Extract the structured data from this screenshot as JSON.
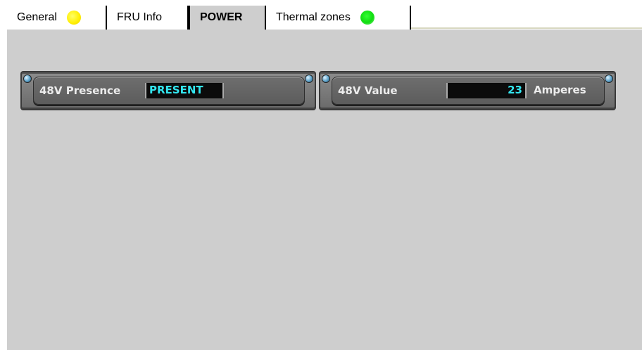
{
  "tabs": [
    {
      "label": "General",
      "status": "yellow"
    },
    {
      "label": "FRU Info"
    },
    {
      "label": "POWER",
      "active": true
    },
    {
      "label": "Thermal zones",
      "status": "green"
    }
  ],
  "widgets": {
    "presence": {
      "label": "48V Presence",
      "value": "PRESENT"
    },
    "value": {
      "label": "48V Value",
      "value": "23",
      "unit": "Amperes"
    }
  },
  "colors": {
    "panel_bg": "#cecece",
    "value_text": "#33e6f0",
    "status_yellow": "#ffee00",
    "status_green": "#11dd11"
  }
}
